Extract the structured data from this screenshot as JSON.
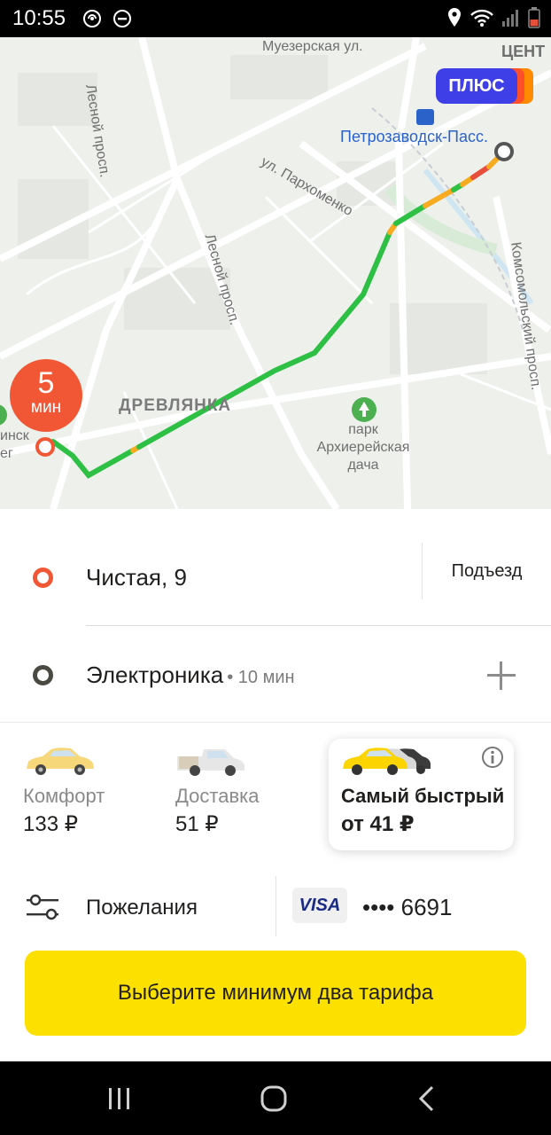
{
  "status_bar": {
    "time": "10:55",
    "left_icons": [
      "sync-icon",
      "do-not-disturb-icon"
    ],
    "right_icons": [
      "location-icon",
      "wifi-icon",
      "signal-icon",
      "battery-icon"
    ]
  },
  "map": {
    "plus_badge": "ПЛЮС",
    "eta": {
      "value": "5",
      "unit": "мин"
    },
    "labels": {
      "muezerskaya": "Муезерская ул.",
      "center": "ЦЕНТ",
      "lesnoy_top": "Лесной просп.",
      "lesnoy_mid": "Лесной просп.",
      "parkhomenko": "ул. Пархоменко",
      "komsomolsky": "Комсомольский просп.",
      "station": "Петрозаводск-Пасс.",
      "district": "ДРЕВЛЯНКА",
      "park": "парк Архиерейская дача",
      "left_edge": "инск\nег"
    },
    "colors": {
      "route_free": "#2ec045",
      "route_slow": "#f6ab21",
      "route_jam": "#e84f3a",
      "origin": "#f25735"
    }
  },
  "route": {
    "from": {
      "address": "Чистая, 9",
      "entrance_label": "Подъезд"
    },
    "to": {
      "address": "Электроника",
      "time": "• 10 мин"
    }
  },
  "tariffs": [
    {
      "name": "Комфорт",
      "price": "133 ₽"
    },
    {
      "name": "Доставка",
      "price": "51 ₽"
    },
    {
      "name": "Самый быстрый",
      "price": "от 41 ₽",
      "selected": true
    }
  ],
  "options": {
    "wishes_label": "Пожелания",
    "card_brand": "VISA",
    "card_number": "•••• 6691"
  },
  "cta_label": "Выберите минимум два тарифа",
  "accent_color": "#fce000"
}
